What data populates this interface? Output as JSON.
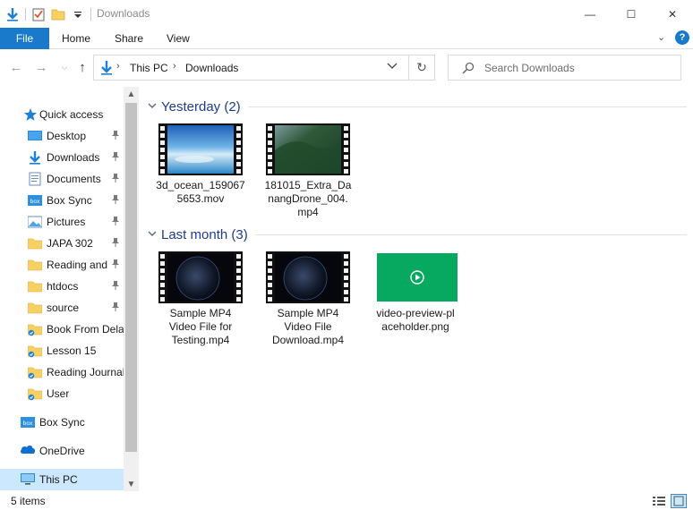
{
  "window": {
    "title": "Downloads",
    "controls": {
      "minimize": "—",
      "maximize": "☐",
      "close": "✕"
    }
  },
  "ribbon": {
    "file_tab": "File",
    "tabs": [
      "Home",
      "Share",
      "View"
    ],
    "expand_glyph": "⌄",
    "help_glyph": "?"
  },
  "address": {
    "crumbs": [
      "This PC",
      "Downloads"
    ],
    "search_placeholder": "Search Downloads"
  },
  "nav": {
    "quick_access": "Quick access",
    "pinned": [
      {
        "label": "Desktop",
        "icon": "desktop-icon",
        "pinned": true
      },
      {
        "label": "Downloads",
        "icon": "downloads-icon",
        "pinned": true
      },
      {
        "label": "Documents",
        "icon": "documents-icon",
        "pinned": true
      },
      {
        "label": "Box Sync",
        "icon": "box-icon",
        "pinned": true
      },
      {
        "label": "Pictures",
        "icon": "pictures-icon",
        "pinned": true
      },
      {
        "label": "JAPA 302",
        "icon": "folder-icon",
        "pinned": true
      },
      {
        "label": "Reading and",
        "icon": "folder-icon",
        "pinned": true
      },
      {
        "label": "htdocs",
        "icon": "folder-icon",
        "pinned": true
      },
      {
        "label": "source",
        "icon": "folder-icon",
        "pinned": true
      },
      {
        "label": "Book From Delay",
        "icon": "synced-folder-icon",
        "pinned": false
      },
      {
        "label": "Lesson 15",
        "icon": "synced-folder-icon",
        "pinned": false
      },
      {
        "label": "Reading Journals",
        "icon": "synced-folder-icon",
        "pinned": false
      },
      {
        "label": "User",
        "icon": "synced-folder-icon",
        "pinned": false
      }
    ],
    "box_sync": "Box Sync",
    "onedrive": "OneDrive",
    "this_pc": "This PC"
  },
  "groups": [
    {
      "title": "Yesterday (2)",
      "files": [
        {
          "name": "3d_ocean_1590675653.mov",
          "display": "3d_ocean_159067\n5653.mov",
          "thumb": "ocean"
        },
        {
          "name": "181015_Extra_DanangDrone_004.mp4",
          "display": "181015_Extra_Da\nnangDrone_004.\nmp4",
          "thumb": "forest"
        }
      ]
    },
    {
      "title": "Last month (3)",
      "files": [
        {
          "name": "Sample MP4 Video File for Testing.mp4",
          "display": "Sample MP4\nVideo File for\nTesting.mp4",
          "thumb": "earth"
        },
        {
          "name": "Sample MP4 Video File Download.mp4",
          "display": "Sample MP4\nVideo File\nDownload.mp4",
          "thumb": "earth"
        },
        {
          "name": "video-preview-placeholder.png",
          "display": "video-preview-pl\naceholder.png",
          "thumb": "placeholder"
        }
      ]
    }
  ],
  "status": {
    "count": "5 items"
  },
  "colors": {
    "accent": "#1979ca",
    "group_title": "#1e3c8c",
    "selection": "#cce8ff",
    "placeholder_green": "#07a860"
  }
}
